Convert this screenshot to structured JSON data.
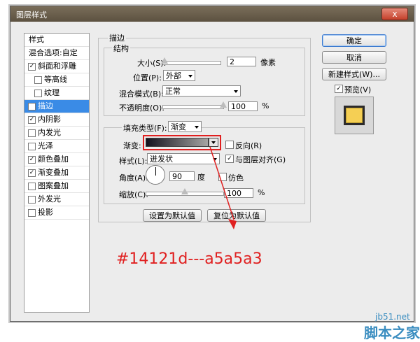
{
  "window": {
    "title": "图层样式",
    "close": "x"
  },
  "left_panel": {
    "items": [
      {
        "label": "样式",
        "checked": false,
        "checkbox": false,
        "indent": false,
        "selected": false
      },
      {
        "label": "混合选项:自定",
        "checked": false,
        "checkbox": false,
        "indent": false,
        "selected": false
      },
      {
        "label": "斜面和浮雕",
        "checked": true,
        "checkbox": true,
        "indent": false,
        "selected": false
      },
      {
        "label": "等高线",
        "checked": false,
        "checkbox": true,
        "indent": true,
        "selected": false
      },
      {
        "label": "纹理",
        "checked": false,
        "checkbox": true,
        "indent": true,
        "selected": false
      },
      {
        "label": "描边",
        "checked": true,
        "checkbox": true,
        "indent": false,
        "selected": true
      },
      {
        "label": "内阴影",
        "checked": true,
        "checkbox": true,
        "indent": false,
        "selected": false
      },
      {
        "label": "内发光",
        "checked": false,
        "checkbox": true,
        "indent": false,
        "selected": false
      },
      {
        "label": "光泽",
        "checked": false,
        "checkbox": true,
        "indent": false,
        "selected": false
      },
      {
        "label": "颜色叠加",
        "checked": true,
        "checkbox": true,
        "indent": false,
        "selected": false
      },
      {
        "label": "渐变叠加",
        "checked": true,
        "checkbox": true,
        "indent": false,
        "selected": false
      },
      {
        "label": "图案叠加",
        "checked": false,
        "checkbox": true,
        "indent": false,
        "selected": false
      },
      {
        "label": "外发光",
        "checked": false,
        "checkbox": true,
        "indent": false,
        "selected": false
      },
      {
        "label": "投影",
        "checked": false,
        "checkbox": true,
        "indent": false,
        "selected": false
      }
    ]
  },
  "stroke": {
    "group_title": "描边",
    "structure_title": "结构",
    "size_label": "大小(S):",
    "size_value": "2",
    "size_unit": "像素",
    "size_level": 0.02,
    "position_label": "位置(P):",
    "position_value": "外部",
    "blend_label": "混合模式(B):",
    "blend_value": "正常",
    "opacity_label": "不透明度(O):",
    "opacity_value": "100",
    "opacity_unit": "%",
    "opacity_level": 1.0,
    "fill_type_label": "填充类型(F):",
    "fill_type_value": "渐变",
    "gradient_label": "渐变:",
    "gradient_start": "#14121d",
    "gradient_end": "#a5a5a3",
    "reverse_label": "反向(R)",
    "reverse_checked": false,
    "style_label": "样式(L):",
    "style_value": "迸发状",
    "align_label": "与图层对齐(G)",
    "align_checked": true,
    "angle_label": "角度(A):",
    "angle_value": "90",
    "angle_unit": "度",
    "dither_label": "仿色",
    "dither_checked": false,
    "scale_label": "缩放(C):",
    "scale_value": "100",
    "scale_unit": "%",
    "scale_level": 0.5,
    "set_default": "设置为默认值",
    "reset_default": "复位为默认值"
  },
  "buttons": {
    "ok": "确定",
    "cancel": "取消",
    "new_style": "新建样式(W)...",
    "preview_label": "预览(V)",
    "preview_checked": true
  },
  "annotation": {
    "text": "#14121d---a5a5a3",
    "color": "#e02020"
  },
  "watermark": {
    "line1": "jb51.net",
    "line2": "脚本之家"
  }
}
